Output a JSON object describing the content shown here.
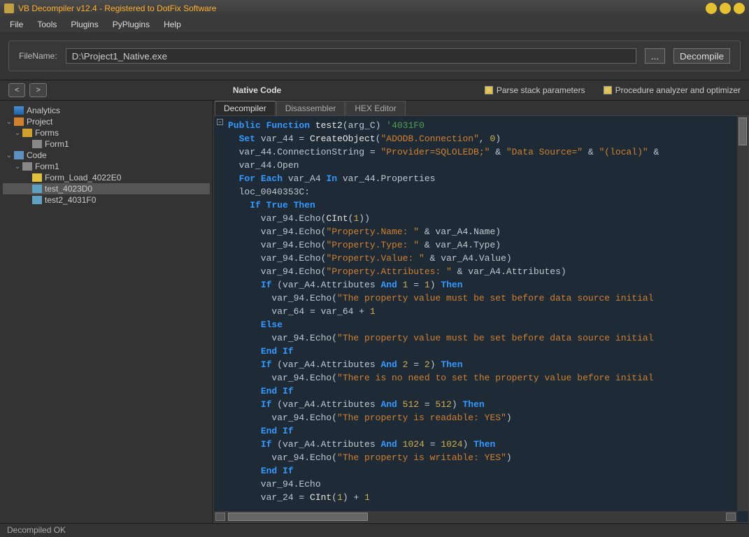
{
  "window": {
    "title": "VB Decompiler v12.4 - Registered to DotFix Software"
  },
  "menu": {
    "file": "File",
    "tools": "Tools",
    "plugins": "Plugins",
    "pyplugins": "PyPlugins",
    "help": "Help"
  },
  "toolbar": {
    "filename_label": "FileName:",
    "filename_value": "D:\\Project1_Native.exe",
    "browse": "...",
    "decompile": "Decompile"
  },
  "nav": {
    "back": "<",
    "fwd": ">",
    "title": "Native Code",
    "chk1": "Parse stack parameters",
    "chk2": "Procedure analyzer and optimizer"
  },
  "tree": {
    "analytics": "Analytics",
    "project": "Project",
    "forms": "Forms",
    "form1": "Form1",
    "code": "Code",
    "form1c": "Form1",
    "fn1": "Form_Load_4022E0",
    "fn2": "test_4023D0",
    "fn3": "test2_4031F0"
  },
  "tabs": {
    "decompiler": "Decompiler",
    "disassembler": "Disassembler",
    "hex": "HEX Editor"
  },
  "code_lines": [
    [
      [
        "kw",
        "Public Function"
      ],
      [
        "fn",
        " test2"
      ],
      [
        "op",
        "(arg_C) "
      ],
      [
        "cm",
        "'4031F0"
      ]
    ],
    [
      [
        "op",
        "  "
      ],
      [
        "kw",
        "Set"
      ],
      [
        "op",
        " var_44 = "
      ],
      [
        "fn",
        "CreateObject"
      ],
      [
        "op",
        "("
      ],
      [
        "str",
        "\"ADODB.Connection\""
      ],
      [
        "op",
        ", "
      ],
      [
        "num",
        "0"
      ],
      [
        "op",
        ")"
      ]
    ],
    [
      [
        "op",
        "  var_44.ConnectionString = "
      ],
      [
        "str",
        "\"Provider=SQLOLEDB;\""
      ],
      [
        "op",
        " & "
      ],
      [
        "str",
        "\"Data Source=\""
      ],
      [
        "op",
        " & "
      ],
      [
        "str",
        "\"(local)\""
      ],
      [
        "op",
        " &"
      ]
    ],
    [
      [
        "op",
        "  var_44.Open"
      ]
    ],
    [
      [
        "op",
        "  "
      ],
      [
        "kw",
        "For Each"
      ],
      [
        "op",
        " var_A4 "
      ],
      [
        "kw",
        "In"
      ],
      [
        "op",
        " var_44.Properties"
      ]
    ],
    [
      [
        "op",
        "  loc_0040353C:"
      ]
    ],
    [
      [
        "op",
        "    "
      ],
      [
        "kw",
        "If True Then"
      ]
    ],
    [
      [
        "op",
        "      var_94.Echo("
      ],
      [
        "fn",
        "CInt"
      ],
      [
        "op",
        "("
      ],
      [
        "num",
        "1"
      ],
      [
        "op",
        "))"
      ]
    ],
    [
      [
        "op",
        "      var_94.Echo("
      ],
      [
        "str",
        "\"Property.Name: \""
      ],
      [
        "op",
        " & var_A4.Name)"
      ]
    ],
    [
      [
        "op",
        "      var_94.Echo("
      ],
      [
        "str",
        "\"Property.Type: \""
      ],
      [
        "op",
        " & var_A4.Type)"
      ]
    ],
    [
      [
        "op",
        "      var_94.Echo("
      ],
      [
        "str",
        "\"Property.Value: \""
      ],
      [
        "op",
        " & var_A4.Value)"
      ]
    ],
    [
      [
        "op",
        "      var_94.Echo("
      ],
      [
        "str",
        "\"Property.Attributes: \""
      ],
      [
        "op",
        " & var_A4.Attributes)"
      ]
    ],
    [
      [
        "op",
        "      "
      ],
      [
        "kw",
        "If"
      ],
      [
        "op",
        " (var_A4.Attributes "
      ],
      [
        "kw",
        "And"
      ],
      [
        "op",
        " "
      ],
      [
        "num",
        "1"
      ],
      [
        "op",
        " = "
      ],
      [
        "num",
        "1"
      ],
      [
        "op",
        ") "
      ],
      [
        "kw",
        "Then"
      ]
    ],
    [
      [
        "op",
        "        var_94.Echo("
      ],
      [
        "str",
        "\"The property value must be set before data source initial"
      ]
    ],
    [
      [
        "op",
        "        var_64 = var_64 + "
      ],
      [
        "num",
        "1"
      ]
    ],
    [
      [
        "op",
        "      "
      ],
      [
        "kw",
        "Else"
      ]
    ],
    [
      [
        "op",
        "        var_94.Echo("
      ],
      [
        "str",
        "\"The property value must be set before data source initial"
      ]
    ],
    [
      [
        "op",
        "      "
      ],
      [
        "kw",
        "End If"
      ]
    ],
    [
      [
        "op",
        "      "
      ],
      [
        "kw",
        "If"
      ],
      [
        "op",
        " (var_A4.Attributes "
      ],
      [
        "kw",
        "And"
      ],
      [
        "op",
        " "
      ],
      [
        "num",
        "2"
      ],
      [
        "op",
        " = "
      ],
      [
        "num",
        "2"
      ],
      [
        "op",
        ") "
      ],
      [
        "kw",
        "Then"
      ]
    ],
    [
      [
        "op",
        "        var_94.Echo("
      ],
      [
        "str",
        "\"There is no need to set the property value before initial"
      ]
    ],
    [
      [
        "op",
        "      "
      ],
      [
        "kw",
        "End If"
      ]
    ],
    [
      [
        "op",
        "      "
      ],
      [
        "kw",
        "If"
      ],
      [
        "op",
        " (var_A4.Attributes "
      ],
      [
        "kw",
        "And"
      ],
      [
        "op",
        " "
      ],
      [
        "num",
        "512"
      ],
      [
        "op",
        " = "
      ],
      [
        "num",
        "512"
      ],
      [
        "op",
        ") "
      ],
      [
        "kw",
        "Then"
      ]
    ],
    [
      [
        "op",
        "        var_94.Echo("
      ],
      [
        "str",
        "\"The property is readable: YES\""
      ],
      [
        "op",
        ")"
      ]
    ],
    [
      [
        "op",
        "      "
      ],
      [
        "kw",
        "End If"
      ]
    ],
    [
      [
        "op",
        "      "
      ],
      [
        "kw",
        "If"
      ],
      [
        "op",
        " (var_A4.Attributes "
      ],
      [
        "kw",
        "And"
      ],
      [
        "op",
        " "
      ],
      [
        "num",
        "1024"
      ],
      [
        "op",
        " = "
      ],
      [
        "num",
        "1024"
      ],
      [
        "op",
        ") "
      ],
      [
        "kw",
        "Then"
      ]
    ],
    [
      [
        "op",
        "        var_94.Echo("
      ],
      [
        "str",
        "\"The property is writable: YES\""
      ],
      [
        "op",
        ")"
      ]
    ],
    [
      [
        "op",
        "      "
      ],
      [
        "kw",
        "End If"
      ]
    ],
    [
      [
        "op",
        "      var_94.Echo"
      ]
    ],
    [
      [
        "op",
        "      var_24 = "
      ],
      [
        "fn",
        "CInt"
      ],
      [
        "op",
        "("
      ],
      [
        "num",
        "1"
      ],
      [
        "op",
        ") + "
      ],
      [
        "num",
        "1"
      ]
    ]
  ],
  "status": "Decompiled OK"
}
